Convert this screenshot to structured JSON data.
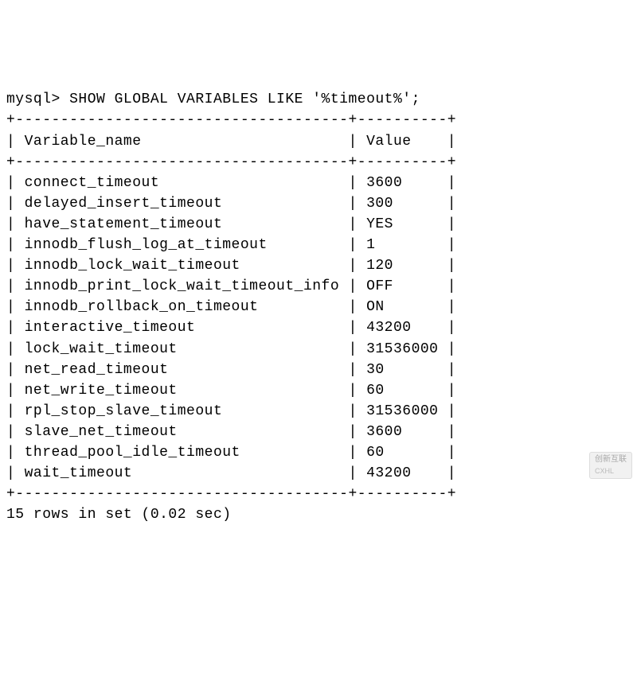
{
  "prompt_prefix": "mysql> ",
  "command": "SHOW GLOBAL VARIABLES LIKE '%timeout%';",
  "headers": [
    "Variable_name",
    "Value"
  ],
  "rows": [
    {
      "name": "connect_timeout",
      "value": "3600"
    },
    {
      "name": "delayed_insert_timeout",
      "value": "300"
    },
    {
      "name": "have_statement_timeout",
      "value": "YES"
    },
    {
      "name": "innodb_flush_log_at_timeout",
      "value": "1"
    },
    {
      "name": "innodb_lock_wait_timeout",
      "value": "120"
    },
    {
      "name": "innodb_print_lock_wait_timeout_info",
      "value": "OFF"
    },
    {
      "name": "innodb_rollback_on_timeout",
      "value": "ON"
    },
    {
      "name": "interactive_timeout",
      "value": "43200"
    },
    {
      "name": "lock_wait_timeout",
      "value": "31536000"
    },
    {
      "name": "net_read_timeout",
      "value": "30"
    },
    {
      "name": "net_write_timeout",
      "value": "60"
    },
    {
      "name": "rpl_stop_slave_timeout",
      "value": "31536000"
    },
    {
      "name": "slave_net_timeout",
      "value": "3600"
    },
    {
      "name": "thread_pool_idle_timeout",
      "value": "60"
    },
    {
      "name": "wait_timeout",
      "value": "43200"
    }
  ],
  "col_widths": {
    "name": 37,
    "value": 10
  },
  "footer_rows": 15,
  "footer_time": "0.02 sec",
  "watermark": {
    "brand": "创新互联",
    "sub": "CXHL"
  }
}
